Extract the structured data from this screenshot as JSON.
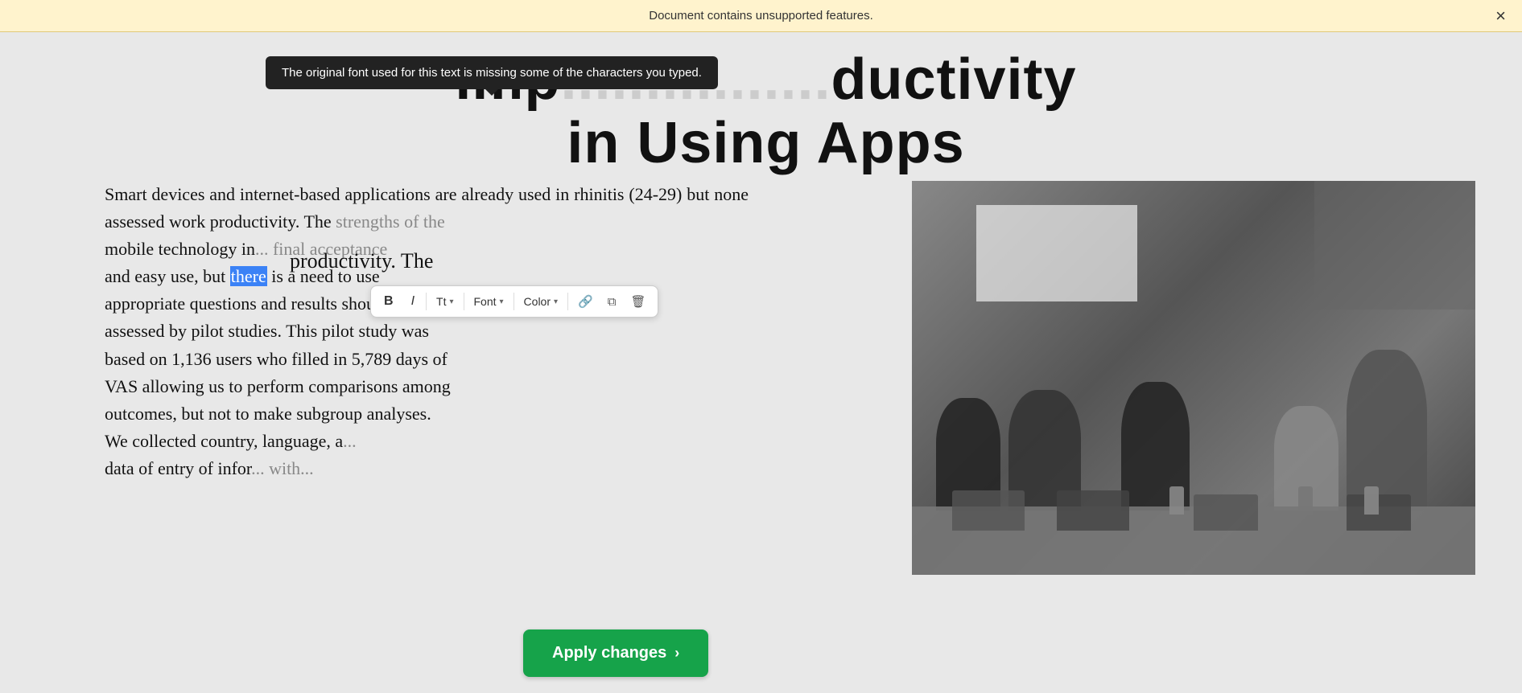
{
  "warning": {
    "text": "Document contains unsupported features.",
    "close_label": "×"
  },
  "tooltip": {
    "text": "The original font used for this text is missing some of the characters you typed."
  },
  "title": {
    "line1": "imp......ductivity",
    "line2": "in Using Apps",
    "partial_left": "imp",
    "partial_right": "ductivity",
    "full_line2": "in Using Apps"
  },
  "body": {
    "text": "Smart devices and internet-based applications are already used in rhinitis (24-29) but none assessed work productivity. The strengths of the mobile technology in... final acceptance and easy use, but there is a need to use appropriate questions and results should be assessed by pilot studies. This pilot study was based on 1,136 users who filled in 5,789 days of VAS allowing us to perform comparisons among outcomes, but not to make subgroup analyses. We collected country, language, a... data of entry of infor... with..."
  },
  "floating_word": "productivity. The",
  "selected_word": "there",
  "toolbar": {
    "bold_label": "B",
    "italic_label": "I",
    "size_label": "Tt",
    "font_label": "Font",
    "color_label": "Color",
    "link_icon": "🔗",
    "copy_icon": "⧉",
    "delete_icon": "🗑",
    "font_dropdown": "▾",
    "color_dropdown": "▾",
    "size_dropdown": "▾"
  },
  "apply_button": {
    "label": "Apply changes",
    "arrow": "›"
  },
  "colors": {
    "warning_bg": "#fff3cd",
    "selected_bg": "#3b82f6",
    "apply_bg": "#16a34a",
    "toolbar_bg": "#ffffff"
  }
}
